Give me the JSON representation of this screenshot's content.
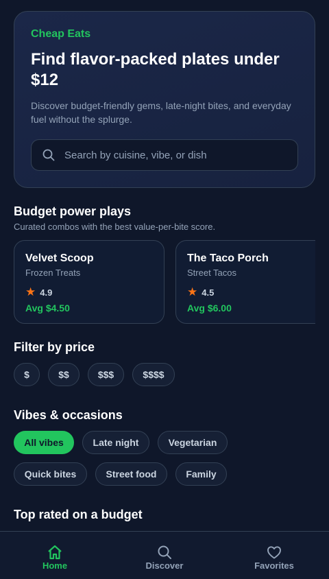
{
  "hero": {
    "eyebrow": "Cheap Eats",
    "title": "Find flavor-packed plates under $12",
    "subtitle": "Discover budget-friendly gems, late-night bites, and everyday fuel without the splurge.",
    "search_placeholder": "Search by cuisine, vibe, or dish"
  },
  "power_plays": {
    "title": "Budget power plays",
    "subtitle": "Curated combos with the best value-per-bite score.",
    "items": [
      {
        "name": "Velvet Scoop",
        "category": "Frozen Treats",
        "rating": "4.9",
        "avg": "Avg $4.50"
      },
      {
        "name": "The Taco Porch",
        "category": "Street Tacos",
        "rating": "4.5",
        "avg": "Avg $6.00"
      }
    ]
  },
  "price_filter": {
    "title": "Filter by price",
    "options": [
      "$",
      "$$",
      "$$$",
      "$$$$"
    ]
  },
  "vibes": {
    "title": "Vibes & occasions",
    "options": [
      "All vibes",
      "Late night",
      "Vegetarian",
      "Quick bites",
      "Street food",
      "Family"
    ],
    "selected": "All vibes"
  },
  "top_rated": {
    "title": "Top rated on a budget"
  },
  "nav": {
    "items": [
      {
        "label": "Home",
        "icon": "home-icon",
        "active": true
      },
      {
        "label": "Discover",
        "icon": "search-icon",
        "active": false
      },
      {
        "label": "Favorites",
        "icon": "heart-icon",
        "active": false
      }
    ]
  },
  "colors": {
    "accent": "#22c55e",
    "background": "#0f172a",
    "star": "#f97316"
  }
}
